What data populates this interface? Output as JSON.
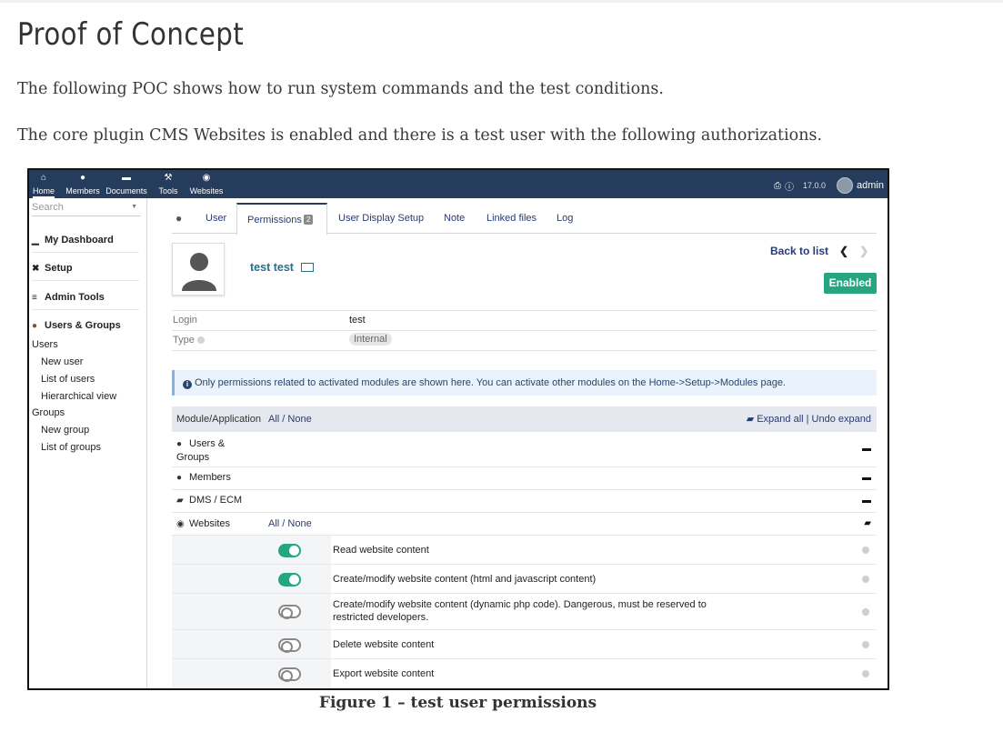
{
  "article": {
    "heading": "Proof of Concept",
    "para1": "The following POC shows how to run system commands and the test conditions.",
    "para2": "The core plugin CMS Websites is enabled and there is a test user with the following authorizations.",
    "caption": "Figure 1 – test user permissions"
  },
  "topbar": {
    "nav": [
      {
        "label": "Home",
        "icon": "home-icon"
      },
      {
        "label": "Members",
        "icon": "user-icon"
      },
      {
        "label": "Documents",
        "icon": "folder-icon"
      },
      {
        "label": "Tools",
        "icon": "wrench-icon"
      },
      {
        "label": "Websites",
        "icon": "globe-icon"
      }
    ],
    "version": "17.0.0",
    "user": "admin",
    "bg_color": "#263c5c"
  },
  "sidebar": {
    "search_placeholder": "Search",
    "main": [
      {
        "label": "My Dashboard",
        "icon": "chart-icon"
      },
      {
        "label": "Setup",
        "icon": "tools-icon"
      },
      {
        "label": "Admin Tools",
        "icon": "server-icon"
      },
      {
        "label": "Users & Groups",
        "icon": "user-icon"
      }
    ],
    "users_header": "Users",
    "users_items": [
      "New user",
      "List of users",
      "Hierarchical view"
    ],
    "groups_header": "Groups",
    "groups_items": [
      "New group",
      "List of groups"
    ]
  },
  "tabs": {
    "user": "User",
    "permissions": "Permissions",
    "permissions_count": "2",
    "display_setup": "User Display Setup",
    "note": "Note",
    "linked_files": "Linked files",
    "log": "Log"
  },
  "user_card": {
    "name": "test test",
    "back_to_list": "Back to list",
    "status": "Enabled",
    "status_color": "#25a580"
  },
  "fields": {
    "login_label": "Login",
    "login_value": "test",
    "type_label": "Type",
    "type_value": "Internal"
  },
  "info_message": "Only permissions related to activated modules are shown here. You can activate other modules on the Home->Setup->Modules page.",
  "perm_table": {
    "header_module": "Module/Application",
    "header_all_none": "All / None",
    "header_expand": "Expand all | Undo expand",
    "modules": [
      {
        "label_line1": "Users &",
        "label_line2": "Groups",
        "icon": "users-icon"
      },
      {
        "label_line1": "Members",
        "label_line2": "",
        "icon": "user-icon"
      },
      {
        "label_line1": "DMS / ECM",
        "label_line2": "",
        "icon": "folder-open-icon"
      },
      {
        "label_line1": "Websites",
        "label_line2": "",
        "icon": "globe-icon",
        "all_none": "All / None"
      }
    ],
    "permissions": [
      {
        "label": "Read website content",
        "enabled": true
      },
      {
        "label": "Create/modify website content (html and javascript content)",
        "enabled": true
      },
      {
        "label": "Create/modify website content (dynamic php code). Dangerous, must be reserved to restricted developers.",
        "enabled": false
      },
      {
        "label": "Delete website content",
        "enabled": false
      },
      {
        "label": "Export website content",
        "enabled": false
      }
    ]
  }
}
